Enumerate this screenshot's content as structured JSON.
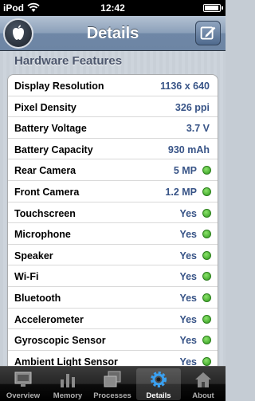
{
  "status_bar": {
    "carrier": "iPod",
    "time": "12:42"
  },
  "nav": {
    "title": "Details"
  },
  "section": {
    "title": "Hardware Features"
  },
  "rows": [
    {
      "label": "Display Resolution",
      "value": "1136 x 640",
      "dot": false
    },
    {
      "label": "Pixel Density",
      "value": "326 ppi",
      "dot": false
    },
    {
      "label": "Battery Voltage",
      "value": "3.7 V",
      "dot": false
    },
    {
      "label": "Battery Capacity",
      "value": "930 mAh",
      "dot": false
    },
    {
      "label": "Rear Camera",
      "value": "5 MP",
      "dot": true
    },
    {
      "label": "Front Camera",
      "value": "1.2 MP",
      "dot": true
    },
    {
      "label": "Touchscreen",
      "value": "Yes",
      "dot": true
    },
    {
      "label": "Microphone",
      "value": "Yes",
      "dot": true
    },
    {
      "label": "Speaker",
      "value": "Yes",
      "dot": true
    },
    {
      "label": "Wi-Fi",
      "value": "Yes",
      "dot": true
    },
    {
      "label": "Bluetooth",
      "value": "Yes",
      "dot": true
    },
    {
      "label": "Accelerometer",
      "value": "Yes",
      "dot": true
    },
    {
      "label": "Gyroscopic Sensor",
      "value": "Yes",
      "dot": true
    },
    {
      "label": "Ambient Light Sensor",
      "value": "Yes",
      "dot": true
    }
  ],
  "tabs": [
    {
      "label": "Overview",
      "icon": "monitor-icon",
      "active": false
    },
    {
      "label": "Memory",
      "icon": "bar-chart-icon",
      "active": false
    },
    {
      "label": "Processes",
      "icon": "windows-icon",
      "active": false
    },
    {
      "label": "Details",
      "icon": "gear-icon",
      "active": true
    },
    {
      "label": "About",
      "icon": "home-icon",
      "active": false
    }
  ],
  "colors": {
    "value_text": "#385487",
    "status_dot": "#3fb52a",
    "nav_bar": "#7d93b0"
  }
}
